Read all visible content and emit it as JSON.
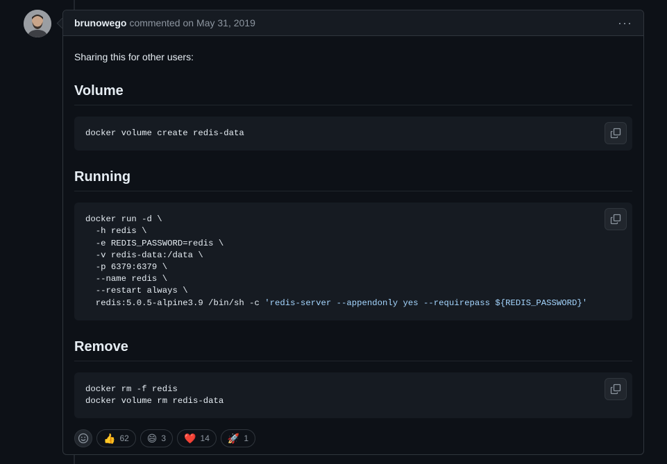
{
  "comment": {
    "author": "brunowego",
    "action": "commented on",
    "date": "May 31, 2019",
    "menu": "···"
  },
  "body": {
    "intro": "Sharing this for other users:",
    "sections": [
      {
        "heading": "Volume",
        "code": [
          "docker volume create redis-data"
        ]
      },
      {
        "heading": "Running",
        "code": [
          "docker run -d \\",
          "  -h redis \\",
          "  -e REDIS_PASSWORD=redis \\",
          "  -v redis-data:/data \\",
          "  -p 6379:6379 \\",
          "  --name redis \\",
          "  --restart always \\",
          "  redis:5.0.5-alpine3.9 /bin/sh -c ",
          "'redis-server --appendonly yes --requirepass ${REDIS_PASSWORD}'"
        ]
      },
      {
        "heading": "Remove",
        "code": [
          "docker rm -f redis",
          "docker volume rm redis-data"
        ]
      }
    ]
  },
  "reactions": [
    {
      "emoji": "👍",
      "count": "62",
      "icon": "thumbs-up-icon"
    },
    {
      "emoji": "😄",
      "count": "3",
      "icon": "laugh-icon"
    },
    {
      "emoji": "❤️",
      "count": "14",
      "icon": "heart-icon"
    },
    {
      "emoji": "🚀",
      "count": "1",
      "icon": "rocket-icon"
    }
  ],
  "colors": {
    "background": "#0d1117",
    "header": "#161b22",
    "border": "#30363d",
    "string": "#a5d6ff",
    "muted": "#8d96a0"
  }
}
